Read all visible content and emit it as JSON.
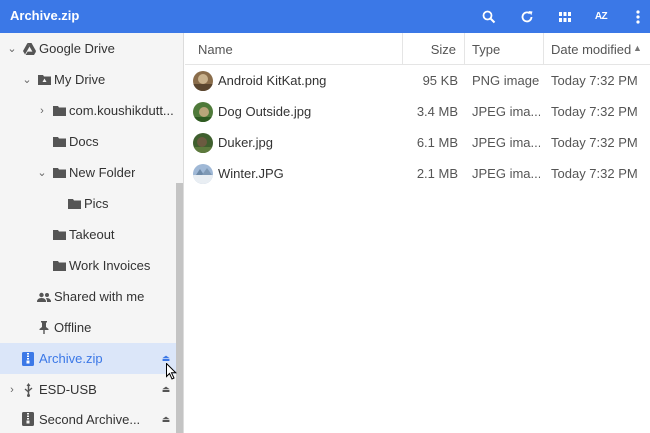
{
  "window": {
    "title": "Archive.zip"
  },
  "toolbar": {
    "az_label": "AZ"
  },
  "sidebar": {
    "items": [
      {
        "label": "Google Drive"
      },
      {
        "label": "My Drive"
      },
      {
        "label": "com.koushikdutt..."
      },
      {
        "label": "Docs"
      },
      {
        "label": "New Folder"
      },
      {
        "label": "Pics"
      },
      {
        "label": "Takeout"
      },
      {
        "label": "Work Invoices"
      },
      {
        "label": "Shared with me"
      },
      {
        "label": "Offline"
      },
      {
        "label": "Archive.zip"
      },
      {
        "label": "ESD-USB"
      },
      {
        "label": "Second Archive..."
      }
    ]
  },
  "table": {
    "headers": {
      "name": "Name",
      "size": "Size",
      "type": "Type",
      "date": "Date modified",
      "sort_arrow": "▲"
    },
    "rows": [
      {
        "name": "Android KitKat.png",
        "size": "95 KB",
        "type": "PNG image",
        "date": "Today 7:32 PM"
      },
      {
        "name": "Dog Outside.jpg",
        "size": "3.4 MB",
        "type": "JPEG ima...",
        "date": "Today 7:32 PM"
      },
      {
        "name": "Duker.jpg",
        "size": "6.1 MB",
        "type": "JPEG ima...",
        "date": "Today 7:32 PM"
      },
      {
        "name": "Winter.JPG",
        "size": "2.1 MB",
        "type": "JPEG ima...",
        "date": "Today 7:32 PM"
      }
    ]
  },
  "colors": {
    "accent": "#3b78e7",
    "selected_bg": "#dbe6f9",
    "sidebar_bg": "#f5f5f5"
  }
}
